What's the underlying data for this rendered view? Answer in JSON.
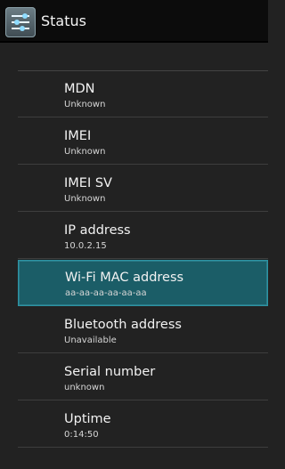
{
  "header": {
    "title": "Status"
  },
  "items": [
    {
      "label": "MDN",
      "value": "Unknown"
    },
    {
      "label": "IMEI",
      "value": "Unknown"
    },
    {
      "label": "IMEI SV",
      "value": "Unknown"
    },
    {
      "label": "IP address",
      "value": "10.0.2.15"
    },
    {
      "label": "Wi-Fi MAC address",
      "value": "aa-aa-aa-aa-aa-aa"
    },
    {
      "label": "Bluetooth address",
      "value": "Unavailable"
    },
    {
      "label": "Serial number",
      "value": "unknown"
    },
    {
      "label": "Uptime",
      "value": "0:14:50"
    }
  ],
  "colors": {
    "selected_background": "#1b5d67",
    "selected_border": "#2d93a3"
  },
  "icons": {
    "app": "settings-sliders-icon"
  }
}
